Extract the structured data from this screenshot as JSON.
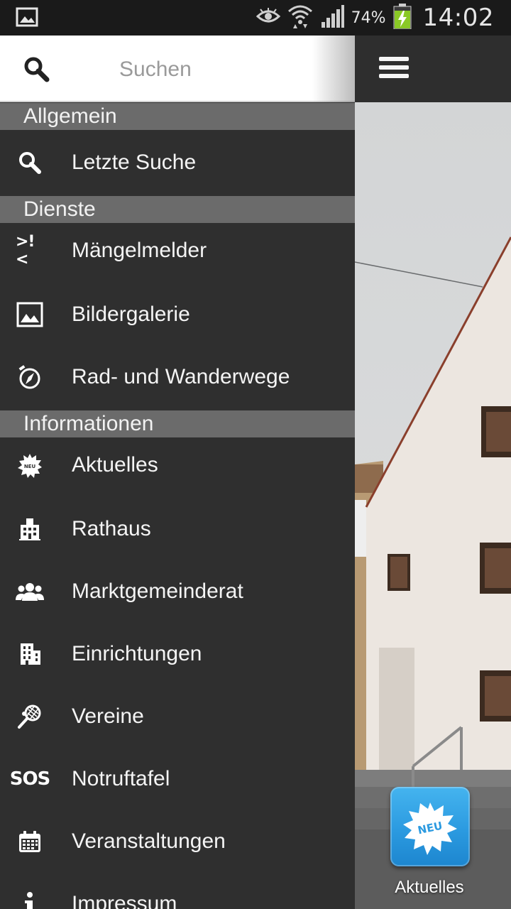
{
  "status_bar": {
    "battery_percent": "74%",
    "clock": "14:02"
  },
  "search": {
    "placeholder": "Suchen"
  },
  "drawer": {
    "sections": [
      {
        "header": "Allgemein"
      },
      {
        "header": "Dienste"
      },
      {
        "header": "Informationen"
      }
    ],
    "items": {
      "letzte_suche": {
        "label": "Letzte Suche",
        "icon": "search-icon"
      },
      "maengelmelder": {
        "label": "Mängelmelder",
        "icon": "alert-icon"
      },
      "bildergalerie": {
        "label": "Bildergalerie",
        "icon": "image-icon"
      },
      "radwege": {
        "label": "Rad- und Wanderwege",
        "icon": "compass-icon"
      },
      "aktuelles": {
        "label": "Aktuelles",
        "icon": "new-badge-icon"
      },
      "rathaus": {
        "label": "Rathaus",
        "icon": "town-hall-icon"
      },
      "gemeinderat": {
        "label": "Marktgemeinderat",
        "icon": "group-icon"
      },
      "einrichtungen": {
        "label": "Einrichtungen",
        "icon": "building-icon"
      },
      "vereine": {
        "label": "Vereine",
        "icon": "tennis-icon"
      },
      "notruftafel": {
        "label": "Notruftafel",
        "icon": "sos-icon"
      },
      "veranstaltungen": {
        "label": "Veranstaltungen",
        "icon": "calendar-icon"
      },
      "impressum": {
        "label": "Impressum",
        "icon": "info-icon"
      }
    },
    "icon_glyphs": {
      "maengelmelder": ">!<",
      "notruftafel": "SOS"
    }
  },
  "main": {
    "tile": {
      "label": "Aktuelles",
      "badge_text": "NEU",
      "icon": "new-badge-icon"
    }
  },
  "colors": {
    "status_bar": "#1a1a1a",
    "drawer_bg": "#2f2f2f",
    "section_header_bg": "#6b6b6b",
    "action_bar": "#2e2e2e",
    "tile_blue": "#2b9ae0",
    "battery_green": "#8ac926"
  }
}
